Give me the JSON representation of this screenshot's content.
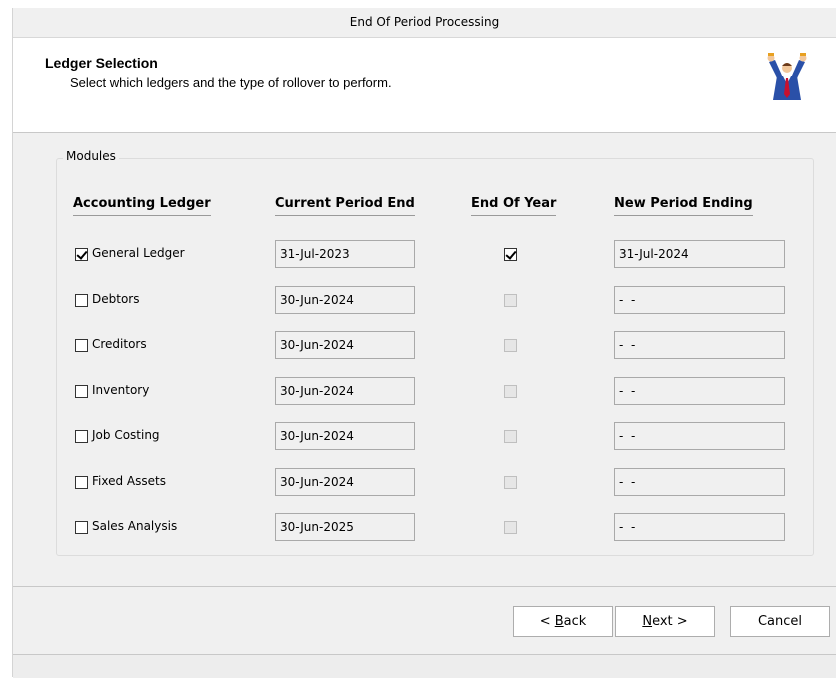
{
  "window": {
    "title": "End Of Period Processing"
  },
  "header": {
    "title": "Ledger Selection",
    "subtitle": "Select which ledgers and the type of rollover to perform."
  },
  "modules": {
    "group_label": "Modules",
    "columns": {
      "ledger": "Accounting Ledger",
      "current": "Current Period End",
      "eoy": "End Of Year",
      "new": "New Period Ending"
    },
    "rows": [
      {
        "label": "General Ledger",
        "selected": true,
        "current_period_end": "31-Jul-2023",
        "end_of_year": true,
        "eoy_enabled": true,
        "new_period_ending": "31-Jul-2024"
      },
      {
        "label": "Debtors",
        "selected": false,
        "current_period_end": "30-Jun-2024",
        "end_of_year": false,
        "eoy_enabled": false,
        "new_period_ending": "-  -"
      },
      {
        "label": "Creditors",
        "selected": false,
        "current_period_end": "30-Jun-2024",
        "end_of_year": false,
        "eoy_enabled": false,
        "new_period_ending": "-  -"
      },
      {
        "label": "Inventory",
        "selected": false,
        "current_period_end": "30-Jun-2024",
        "end_of_year": false,
        "eoy_enabled": false,
        "new_period_ending": "-  -"
      },
      {
        "label": "Job Costing",
        "selected": false,
        "current_period_end": "30-Jun-2024",
        "end_of_year": false,
        "eoy_enabled": false,
        "new_period_ending": "-  -"
      },
      {
        "label": "Fixed Assets",
        "selected": false,
        "current_period_end": "30-Jun-2024",
        "end_of_year": false,
        "eoy_enabled": false,
        "new_period_ending": "-  -"
      },
      {
        "label": "Sales Analysis",
        "selected": false,
        "current_period_end": "30-Jun-2025",
        "end_of_year": false,
        "eoy_enabled": false,
        "new_period_ending": "-  -"
      }
    ]
  },
  "buttons": {
    "back_prefix": "< ",
    "back_key": "B",
    "back_rest": "ack",
    "next_key": "N",
    "next_rest": "ext >",
    "cancel": "Cancel"
  },
  "icons": {
    "header": "celebrating-person-icon"
  },
  "colors": {
    "background": "#f0f0f0",
    "header_bg": "#ffffff",
    "icon_blue": "#2a50a8",
    "icon_red": "#c8102e",
    "icon_gold": "#e8a020"
  }
}
